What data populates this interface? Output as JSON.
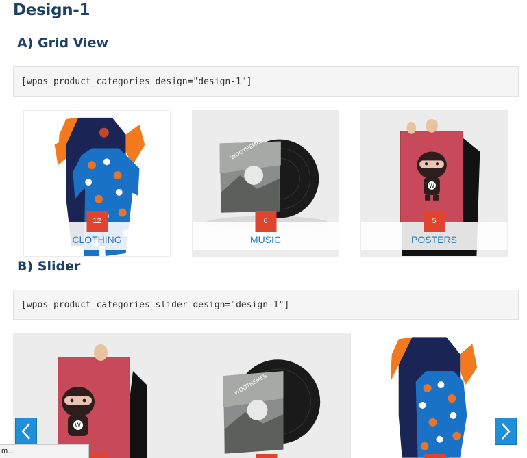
{
  "page": {
    "title": "Design-1",
    "grid_heading": "A) Grid View",
    "grid_shortcode": "[wpos_product_categories design=\"design-1\"]",
    "slider_heading": "B) Slider",
    "slider_shortcode": "[wpos_product_categories_slider design=\"design-1\"]"
  },
  "grid": [
    {
      "label": "CLOTHING",
      "count": "12",
      "image": "onesie-pajamas"
    },
    {
      "label": "MUSIC",
      "count": "6",
      "image": "vinyl-record"
    },
    {
      "label": "POSTERS",
      "count": "5",
      "image": "ninja-poster"
    }
  ],
  "slider": {
    "slides": [
      {
        "image": "ninja-poster"
      },
      {
        "image": "vinyl-record"
      },
      {
        "image": "onesie-pajamas"
      }
    ],
    "prev_icon": "chevron-left-icon",
    "next_icon": "chevron-right-icon"
  },
  "status_bar": {
    "text": "m..."
  },
  "colors": {
    "heading": "#1e3f66",
    "link": "#1f7bbd",
    "badge": "#e0442e",
    "arrow": "#1e8fd8"
  }
}
